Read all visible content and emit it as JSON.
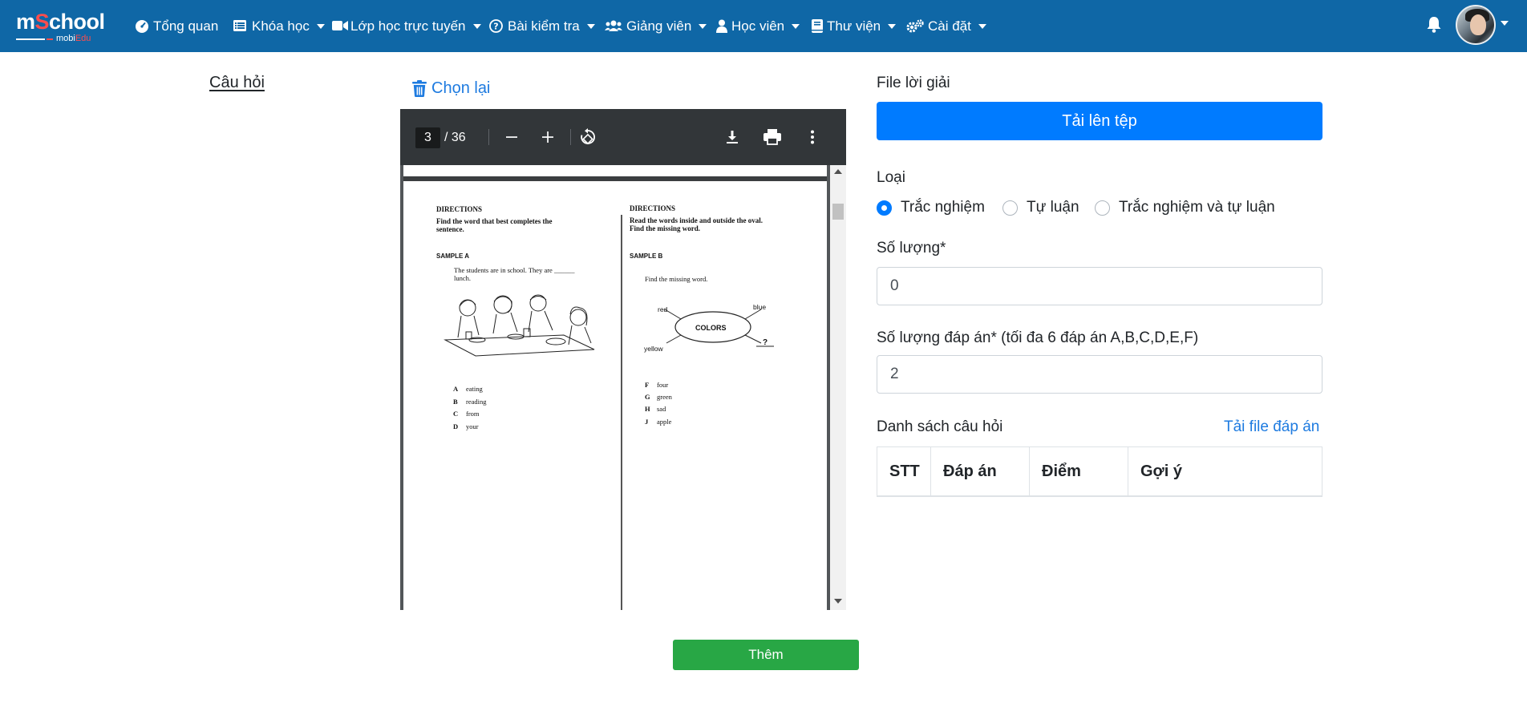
{
  "brand": {
    "name_part1": "m",
    "name_s": "S",
    "name_part2": "chool",
    "sub_part1": "mobi",
    "sub_part2": "Edu"
  },
  "nav": [
    {
      "label": "Tổng quan",
      "icon": "tachometer-icon",
      "caret": false
    },
    {
      "label": "Khóa học",
      "icon": "list-icon",
      "caret": true
    },
    {
      "label": "Lớp học trực tuyến",
      "icon": "video-icon",
      "caret": true
    },
    {
      "label": "Bài kiểm tra",
      "icon": "question-circle-icon",
      "caret": true
    },
    {
      "label": "Giảng viên",
      "icon": "users-icon",
      "caret": true
    },
    {
      "label": "Học viên",
      "icon": "user-icon",
      "caret": true
    },
    {
      "label": "Thư viện",
      "icon": "book-icon",
      "caret": true
    },
    {
      "label": "Cài đặt",
      "icon": "cogs-icon",
      "caret": true
    }
  ],
  "left": {
    "heading": "Câu hỏi"
  },
  "viewer": {
    "reset_label": "Chọn lại",
    "page_current": "3",
    "page_total": "/ 36",
    "page_content": {
      "left_col": {
        "directions_title": "DIRECTIONS",
        "directions_line1": "Find the word that best completes the",
        "directions_line2": "sentence.",
        "sample": "SAMPLE A",
        "prompt_line1": "The students are in school. They are ______",
        "prompt_line2": "lunch.",
        "options": [
          {
            "letter": "A",
            "text": "eating"
          },
          {
            "letter": "B",
            "text": "reading"
          },
          {
            "letter": "C",
            "text": "from"
          },
          {
            "letter": "D",
            "text": "your"
          }
        ]
      },
      "right_col": {
        "directions_title": "DIRECTIONS",
        "directions_line1": "Read the words inside and outside the oval.",
        "directions_line2": "Find the missing word.",
        "sample": "SAMPLE B",
        "prompt": "Find the missing word.",
        "oval_center": "COLORS",
        "oval_words": {
          "red": "red",
          "blue": "blue",
          "yellow": "yellow",
          "missing": "?"
        },
        "options": [
          {
            "letter": "F",
            "text": "four"
          },
          {
            "letter": "G",
            "text": "green"
          },
          {
            "letter": "H",
            "text": "sad"
          },
          {
            "letter": "J",
            "text": "apple"
          }
        ]
      }
    }
  },
  "form": {
    "solution_label": "File lời giải",
    "upload_label": "Tải lên tệp",
    "type_label": "Loại",
    "types": [
      {
        "label": "Trắc nghiệm",
        "checked": true
      },
      {
        "label": "Tự luận",
        "checked": false
      },
      {
        "label": "Trắc nghiệm và tự luận",
        "checked": false
      }
    ],
    "quantity_label": "Số lượng*",
    "quantity_value": "0",
    "answers_label": "Số lượng đáp án* (tối đa 6 đáp án A,B,C,D,E,F)",
    "answers_value": "2",
    "list_label": "Danh sách câu hỏi",
    "download_link": "Tải file đáp án",
    "table_headers": [
      "STT",
      "Đáp án",
      "Điểm",
      "Gợi ý"
    ],
    "submit_label": "Thêm"
  },
  "colors": {
    "navbar": "#0f67a6",
    "primary": "#007bff",
    "success": "#28a745",
    "link": "#1e7be0"
  }
}
